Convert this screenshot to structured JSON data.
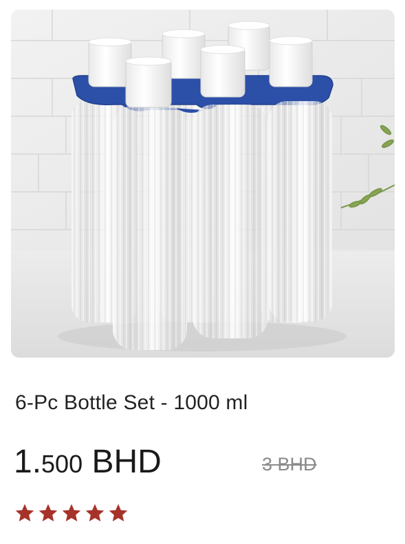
{
  "product": {
    "image_alt": "6-Pc Bottle Set - 1000 ml product photo",
    "title": "6-Pc Bottle Set - 1000 ml",
    "price_whole": "1.",
    "price_fraction": "500",
    "price_currency": " BHD",
    "old_price": "3 BHD",
    "rating_stars": 5,
    "rating_max": 5,
    "star_color": "#a6332a"
  }
}
